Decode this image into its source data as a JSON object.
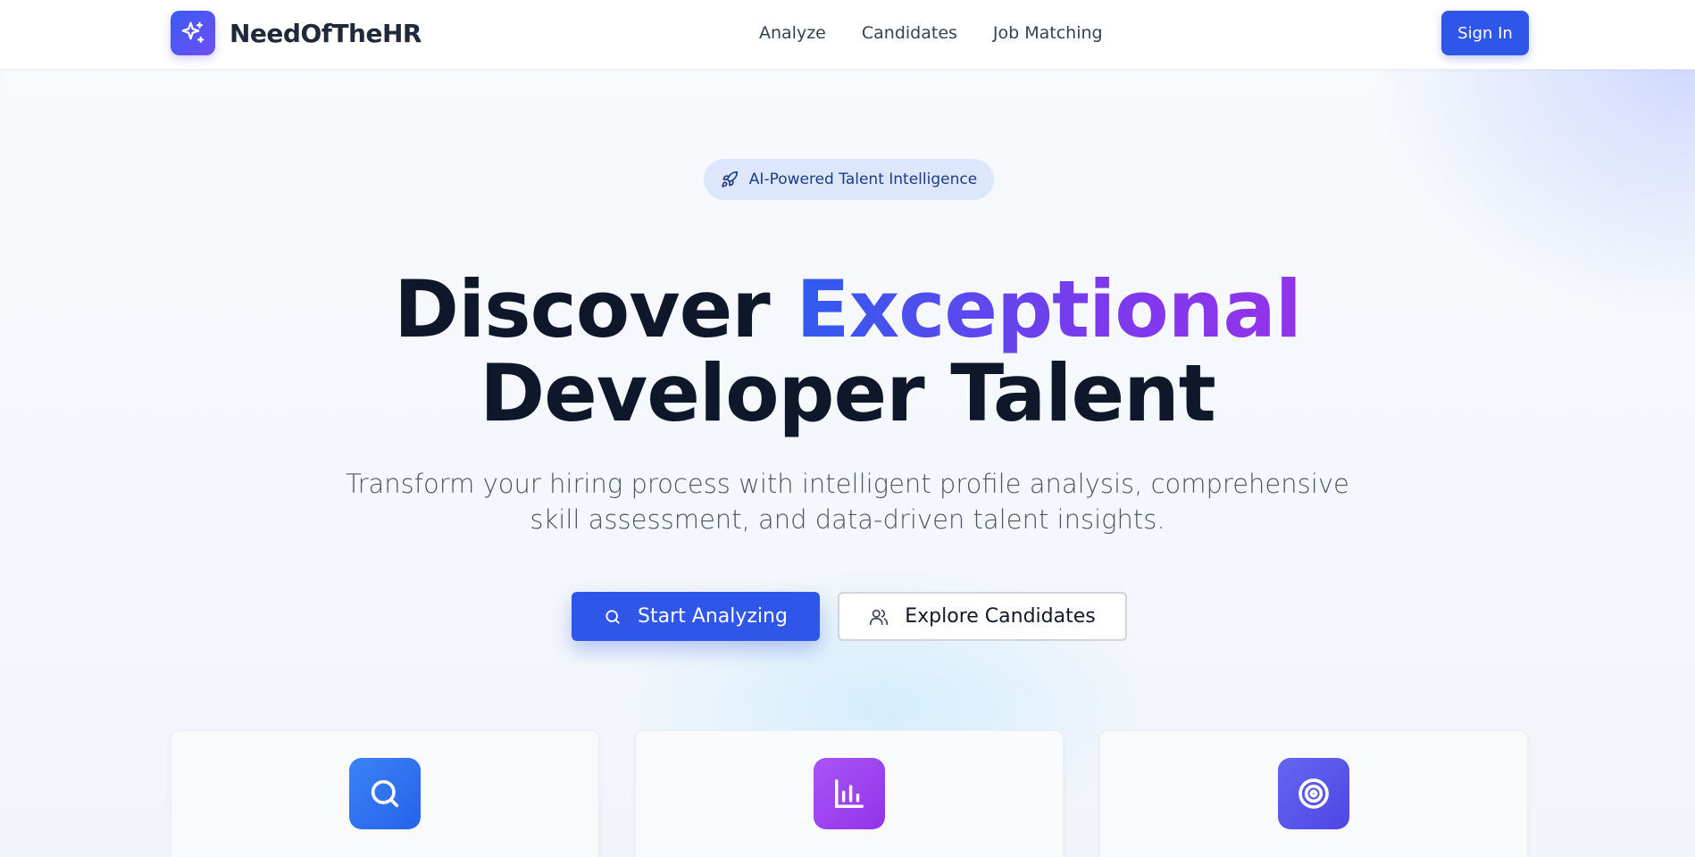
{
  "header": {
    "brand_name": "NeedOfTheHR",
    "brand_icon": "sparkles-icon",
    "nav": [
      {
        "label": "Analyze"
      },
      {
        "label": "Candidates"
      },
      {
        "label": "Job Matching"
      }
    ],
    "signin_label": "Sign In",
    "accent_color": "#2f56e9"
  },
  "hero": {
    "badge_icon": "rocket-icon",
    "badge_text": "AI-Powered Talent Intelligence",
    "headline_part1": "Discover",
    "headline_highlight": "Exceptional",
    "headline_line2": "Developer Talent",
    "subtitle": "Transform your hiring process with intelligent profile analysis, comprehensive skill assessment, and data-driven talent insights.",
    "primary_button": {
      "label": "Start Analyzing",
      "icon": "search-icon"
    },
    "secondary_button": {
      "label": "Explore Candidates",
      "icon": "users-icon"
    }
  },
  "feature_cards": [
    {
      "icon": "search-icon",
      "color": "#3b82f6"
    },
    {
      "icon": "bar-chart-icon",
      "color": "#9333ea"
    },
    {
      "icon": "target-icon",
      "color": "#5b4ff0"
    }
  ]
}
